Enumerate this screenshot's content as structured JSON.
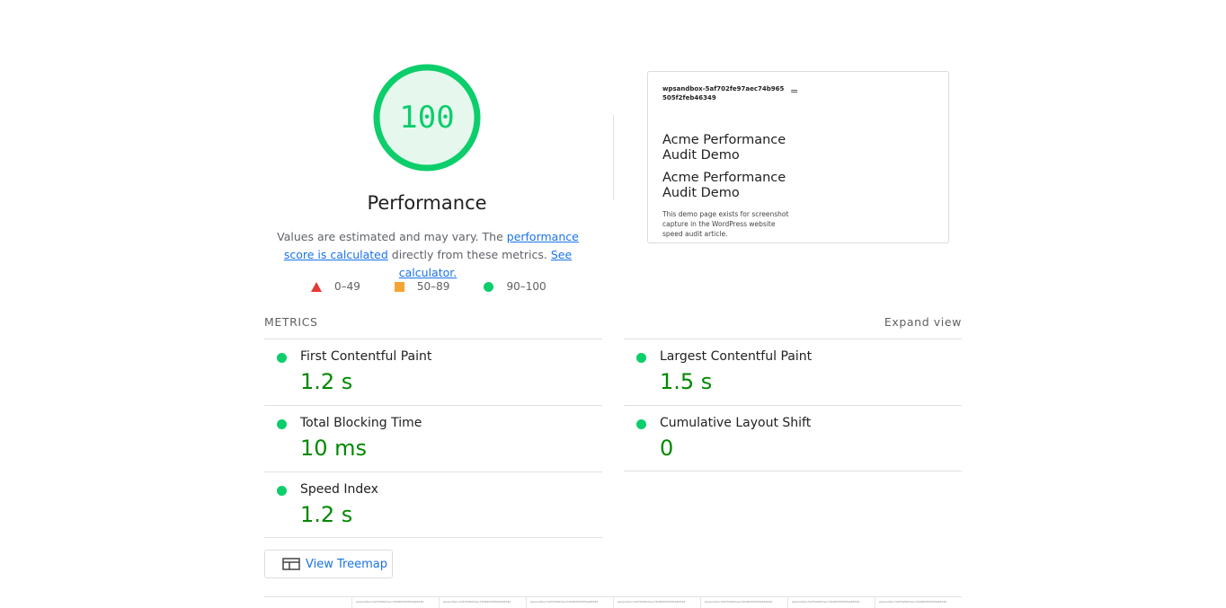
{
  "gauge": {
    "score": "100",
    "title": "Performance",
    "desc_prefix": "Values are estimated and may vary. The ",
    "desc_link1": "performance score is calculated",
    "desc_middle": " directly from these metrics. ",
    "desc_link2": "See calculator.",
    "color": "#0cce6b"
  },
  "legend": [
    {
      "shape": "triangle",
      "range": "0–49",
      "color": "#e53935"
    },
    {
      "shape": "square",
      "range": "50–89",
      "color": "#f4a533"
    },
    {
      "shape": "circle",
      "range": "90–100",
      "color": "#0cce6b"
    }
  ],
  "screenshot": {
    "site": "wpsandbox-5af702fe97aec74b965505f2feb46349",
    "menu_icon": "=",
    "heading1": "Acme Performance Audit Demo",
    "heading2": "Acme Performance Audit Demo",
    "paragraph": "This demo page exists for screenshot capture in the WordPress website speed audit article."
  },
  "metrics": {
    "label": "Metrics",
    "expand": "Expand view",
    "items": [
      {
        "name": "First Contentful Paint",
        "value": "1.2 s"
      },
      {
        "name": "Largest Contentful Paint",
        "value": "1.5 s"
      },
      {
        "name": "Total Blocking Time",
        "value": "10 ms"
      },
      {
        "name": "Cumulative Layout Shift",
        "value": "0"
      },
      {
        "name": "Speed Index",
        "value": "1.2 s"
      }
    ],
    "good_color": "#0cce6b",
    "value_color": "#008800"
  },
  "treemap": {
    "label": "View Treemap"
  },
  "filmstrip": {
    "frames": [
      "",
      "wpsandbox-5af702fe97aec74b965505f2feb46349",
      "wpsandbox-5af702fe97aec74b965505f2feb46349",
      "wpsandbox-5af702fe97aec74b965505f2feb46349",
      "wpsandbox-5af702fe97aec74b965505f2feb46349",
      "wpsandbox-5af702fe97aec74b965505f2feb46349",
      "wpsandbox-5af702fe97aec74b965505f2feb46349",
      "wpsandbox-5af702fe97aec74b965505f2feb46349"
    ]
  }
}
